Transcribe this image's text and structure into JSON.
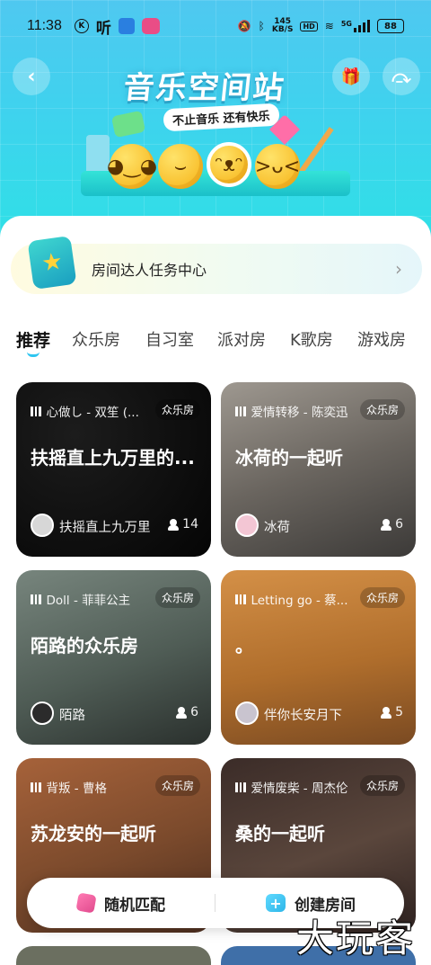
{
  "status_bar": {
    "time": "11:38",
    "ting_label": "听",
    "net_speed_top": "145",
    "net_speed_unit": "KB/S",
    "hd": "HD",
    "network": "5G",
    "battery": "88"
  },
  "header": {
    "title": "音乐空间站",
    "subtitle": "不止音乐 还有快乐",
    "back_icon": "chevron-left-icon",
    "gift_icon": "gift-icon",
    "share_icon": "share-icon"
  },
  "task_center": {
    "label": "房间达人任务中心"
  },
  "tabs": [
    {
      "label": "推荐",
      "active": true
    },
    {
      "label": "众乐房",
      "active": false
    },
    {
      "label": "自习室",
      "active": false
    },
    {
      "label": "派对房",
      "active": false
    },
    {
      "label": "K歌房",
      "active": false
    },
    {
      "label": "游戏房",
      "active": false
    }
  ],
  "rooms": [
    {
      "song": "心做し - 双笙 (...",
      "type": "众乐房",
      "name": "扶摇直上九万里的...",
      "owner": "扶摇直上九万里",
      "count": "14",
      "bg": "#0a0a0a"
    },
    {
      "song": "爱情转移 - 陈奕迅",
      "type": "众乐房",
      "name": "冰荷的一起听",
      "owner": "冰荷",
      "count": "6",
      "bg": "#6f6a63"
    },
    {
      "song": "Doll - 菲菲公主",
      "type": "众乐房",
      "name": "陌路的众乐房",
      "owner": "陌路",
      "count": "6",
      "bg": "#53605a"
    },
    {
      "song": "Letting go - 蔡...",
      "type": "众乐房",
      "name": "。",
      "owner": "伴你长安月下",
      "count": "5",
      "bg": "#b1732f"
    },
    {
      "song": "背叛 - 曹格",
      "type": "众乐房",
      "name": "苏龙安的一起听",
      "owner": "",
      "count": "",
      "bg": "#7b4a2c"
    },
    {
      "song": "爱情废柴 - 周杰伦",
      "type": "众乐房",
      "name": "桑的一起听",
      "owner": "",
      "count": "",
      "bg": "#4a3a33"
    }
  ],
  "bottom_actions": {
    "random_match": "随机匹配",
    "create_room": "创建房间"
  },
  "watermark": "大玩客"
}
